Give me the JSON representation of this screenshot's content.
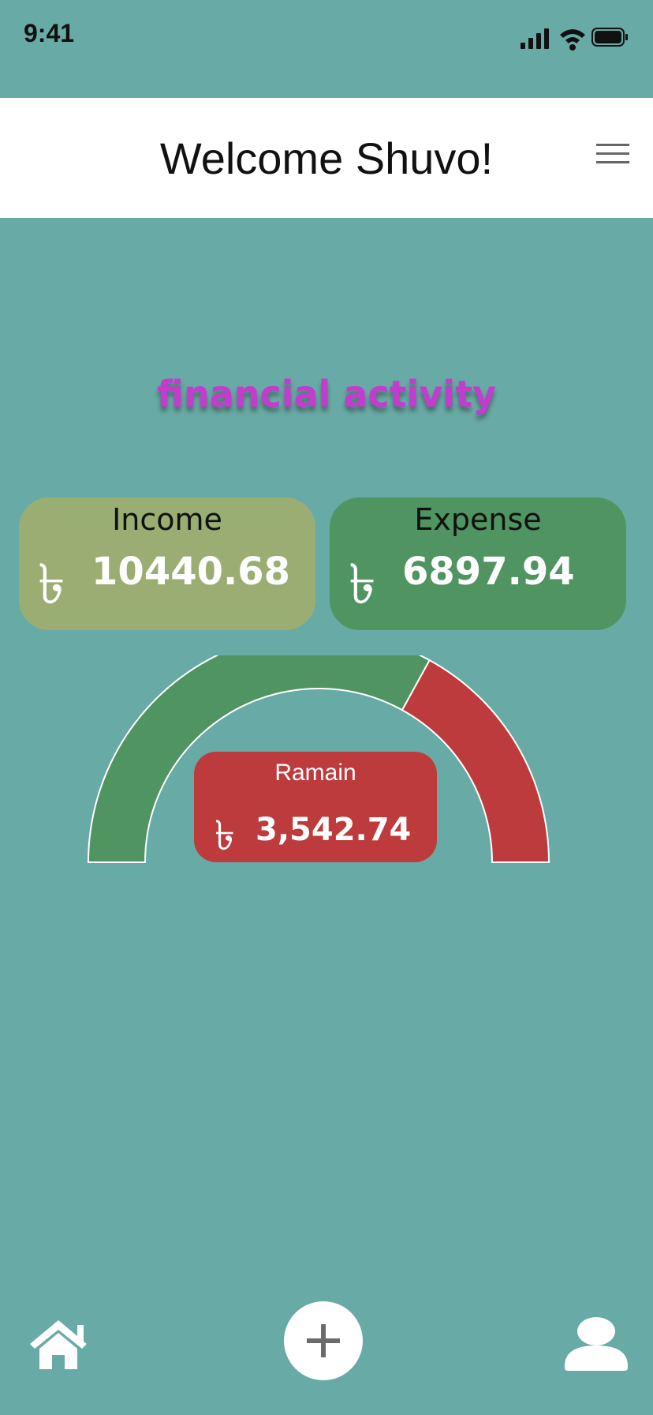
{
  "status_bar": {
    "time": "9:41",
    "icons": [
      "signal-icon",
      "wifi-icon",
      "battery-icon"
    ]
  },
  "header": {
    "title": "Welcome Shuvo!",
    "menu_icon": "hamburger-menu-icon"
  },
  "section_title": "financial activity",
  "income": {
    "label": "Income",
    "currency": "৳",
    "amount": "10440.68"
  },
  "expense": {
    "label": "Expense",
    "currency": "৳",
    "amount": "6897.94"
  },
  "remain": {
    "label": "Ramain",
    "currency": "৳",
    "amount": "3,542.74"
  },
  "gauge": {
    "expense_fraction": 0.66,
    "colors": {
      "income_segment": "#4f9461",
      "remain_segment": "#bd3b3c"
    }
  },
  "bottom_nav": {
    "items": [
      "home-icon",
      "add-icon",
      "profile-icon"
    ]
  },
  "colors": {
    "background": "#68aaa5",
    "header": "#ffffff",
    "title_accent": "#c43ccd",
    "income_card": "#9aae73",
    "expense_card": "#4f9461",
    "remain_card": "#bd3b3c"
  }
}
